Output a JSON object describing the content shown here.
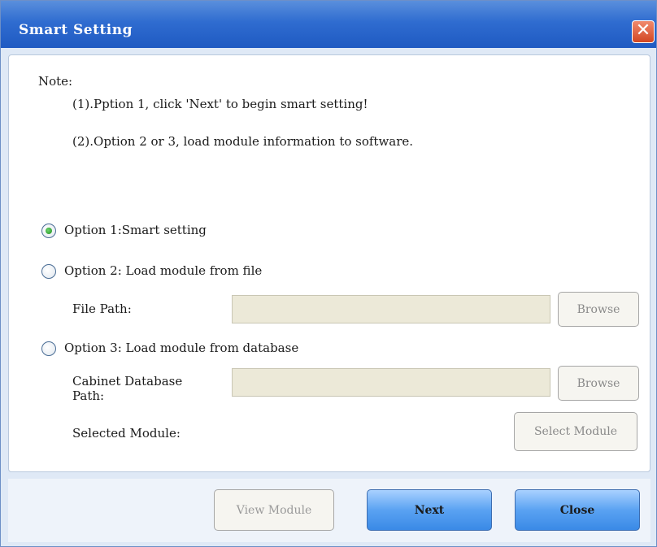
{
  "window": {
    "title": "Smart Setting",
    "close_glyph": "✕"
  },
  "note": {
    "label": "Note:",
    "line1": "(1).Pption 1, click 'Next' to begin smart setting!",
    "line2": "(2).Option 2 or 3, load module information to software."
  },
  "options": {
    "option1": {
      "label": "Option 1:Smart setting",
      "selected": true
    },
    "option2": {
      "label": "Option 2: Load module from file",
      "selected": false
    },
    "option3": {
      "label": "Option 3: Load module from database",
      "selected": false
    }
  },
  "file_path": {
    "label": "File Path:",
    "value": "",
    "browse_label": "Browse"
  },
  "cabinet_db": {
    "label_line1": "Cabinet Database",
    "label_line2": "Path:",
    "value": "",
    "browse_label": "Browse"
  },
  "selected_module": {
    "label": "Selected Module:",
    "button_label": "Select Module"
  },
  "footer": {
    "view_module_label": "View Module",
    "next_label": "Next",
    "close_label": "Close"
  },
  "colors": {
    "titlebar": "#2f6cd0",
    "primary_button": "#5aa2f2",
    "radio_selected": "#1f8f1f"
  }
}
